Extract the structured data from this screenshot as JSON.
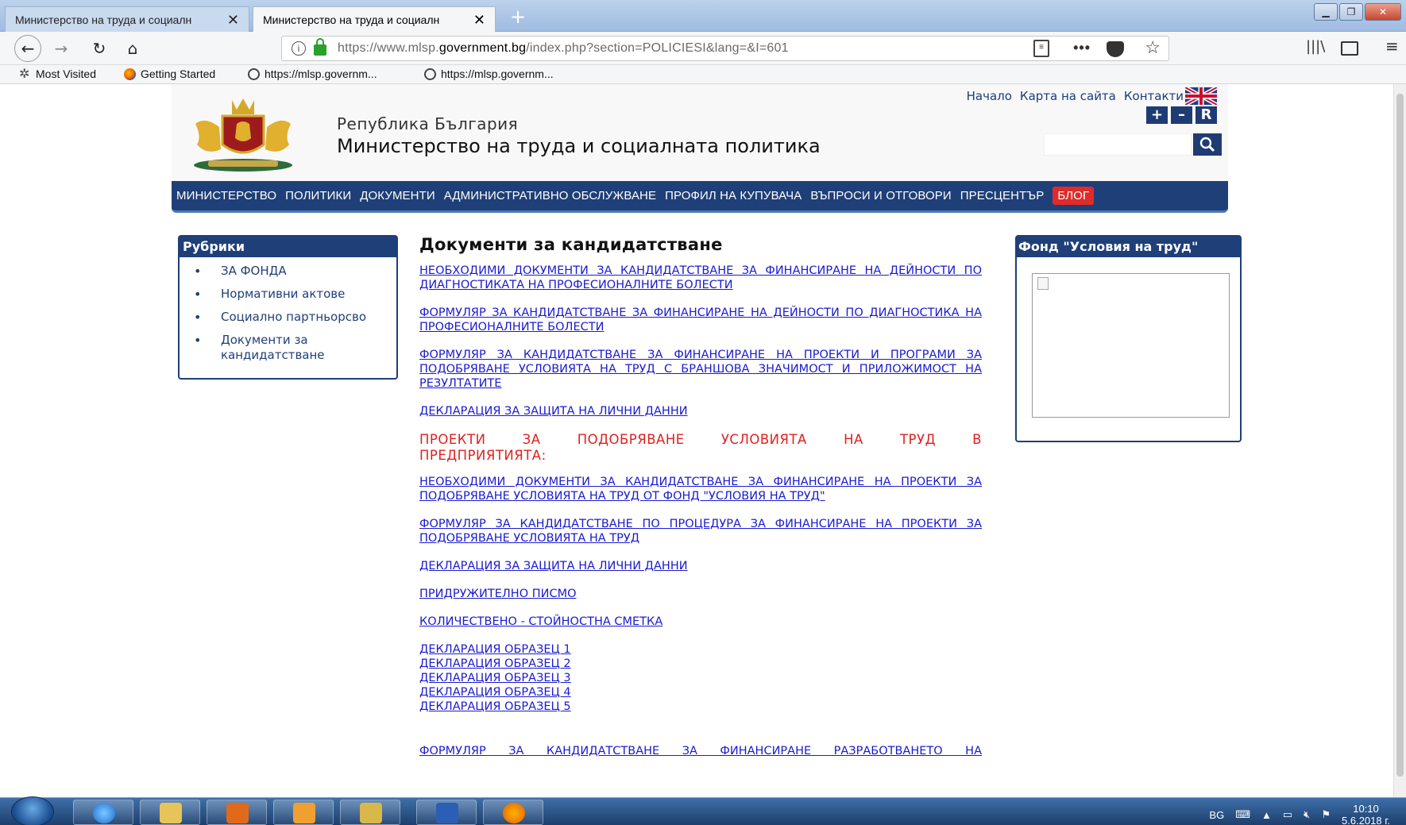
{
  "browser": {
    "tabs": [
      {
        "label": "Министерство на труда и социалн",
        "active": false
      },
      {
        "label": "Министерство на труда и социалн",
        "active": true
      }
    ],
    "new_tab": "+",
    "url_prefix": "https://www.mlsp.",
    "url_domain": "government.bg",
    "url_suffix": "/index.php?section=POLICIESI&lang=&I=601",
    "more": "•••",
    "bookmarks": [
      {
        "label": "Most Visited",
        "icon": "gear-icon"
      },
      {
        "label": "Getting Started",
        "icon": "firefox-icon"
      },
      {
        "label": "https://mlsp.governm...",
        "icon": "globe-icon"
      },
      {
        "label": "https://mlsp.governm...",
        "icon": "globe-icon"
      }
    ]
  },
  "site": {
    "subtitle": "Република България",
    "title": "Министерство на труда и социалната политика",
    "top_links": [
      "Начало",
      "Карта на сайта",
      "Контакти"
    ],
    "font_buttons": [
      "+",
      "–",
      "R"
    ],
    "nav": [
      "МИНИСТЕРСТВО",
      "ПОЛИТИКИ",
      "ДОКУМЕНТИ",
      "АДМИНИСТРАТИВНО ОБСЛУЖВАНЕ",
      "ПРОФИЛ НА КУПУВАЧА",
      "ВЪПРОСИ И ОТГОВОРИ",
      "ПРЕСЦЕНТЪР",
      "БЛОГ"
    ]
  },
  "rubrics": {
    "title": "Рубрики",
    "items": [
      "ЗА ФОНДА",
      "Нормативни актове",
      "Социално партньорсво",
      "Документи за кандидатстване"
    ]
  },
  "content": {
    "title": "Документи за кандидатстване",
    "links1": [
      "НЕОБХОДИМИ ДОКУМЕНТИ ЗА КАНДИДАТСТВАНЕ ЗА ФИНАНСИРАНЕ НА ДЕЙНОСТИ ПО ДИАГНОСТИКАТА НА ПРОФЕСИОНАЛНИТЕ БОЛЕСТИ",
      "ФОРМУЛЯР ЗА КАНДИДАТСТВАНЕ ЗА ФИНАНСИРАНЕ НА ДЕЙНОСТИ ПО ДИАГНОСТИКА НА ПРОФЕСИОНАЛНИТЕ БОЛЕСТИ",
      "ФОРМУЛЯР ЗА КАНДИДАТСТВАНЕ ЗА ФИНАНСИРАНЕ НА ПРОЕКТИ И ПРОГРАМИ ЗА ПОДОБРЯВАНЕ УСЛОВИЯТА НА ТРУД С БРАНШОВА ЗНАЧИМОСТ И ПРИЛОЖИМОСТ НА РЕЗУЛТАТИТЕ",
      "ДЕКЛАРАЦИЯ ЗА ЗАЩИТА НА ЛИЧНИ ДАННИ"
    ],
    "section_heading": "ПРОЕКТИ ЗА ПОДОБРЯВАНЕ УСЛОВИЯТА НА ТРУД В ПРЕДПРИЯТИЯТА:",
    "links2": [
      "НЕОБХОДИМИ ДОКУМЕНТИ ЗА КАНДИДАТСТВАНЕ ЗА ФИНАНСИРАНЕ НА ПРОЕКТИ ЗА ПОДОБРЯВАНЕ УСЛОВИЯТА НА ТРУД ОТ ФОНД \"УСЛОВИЯ НА ТРУД\"",
      "ФОРМУЛЯР ЗА КАНДИДАТСТВАНЕ ПО ПРОЦЕДУРА ЗА ФИНАНСИРАНЕ НА ПРОЕКТИ ЗА ПОДОБРЯВАНЕ УСЛОВИЯТА НА ТРУД",
      "ДЕКЛАРАЦИЯ ЗА ЗАЩИТА НА ЛИЧНИ ДАННИ",
      "ПРИДРУЖИТЕЛНО ПИСМО",
      "КОЛИЧЕСТВЕНО - СТОЙНОСТНА СМЕТКА"
    ],
    "declarations": [
      "ДЕКЛАРАЦИЯ ОБРАЗЕЦ 1",
      "ДЕКЛАРАЦИЯ ОБРАЗЕЦ 2",
      "ДЕКЛАРАЦИЯ ОБРАЗЕЦ 3",
      "ДЕКЛАРАЦИЯ ОБРАЗЕЦ 4",
      "ДЕКЛАРАЦИЯ ОБРАЗЕЦ 5"
    ],
    "last_link": "ФОРМУЛЯР ЗА КАНДИДАТСТВАНЕ ЗА ФИНАНСИРАНЕ РАЗРАБОТВАНЕТО НА"
  },
  "fund_box": {
    "title": "Фонд \"Условия на труд\""
  },
  "taskbar": {
    "lang": "BG",
    "time": "10:10",
    "date": "5.6.2018 г."
  },
  "colors": {
    "brand_blue": "#1f3f78",
    "link_blue": "#1a1ad0",
    "heading_red": "#e02020",
    "blog_red": "#e02b2b"
  }
}
